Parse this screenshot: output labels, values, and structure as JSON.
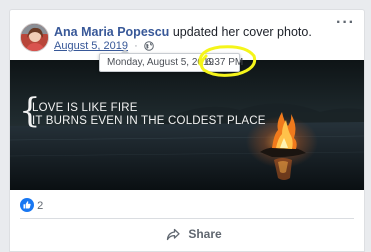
{
  "post": {
    "author_name": "Ana Maria Popescu",
    "action_text": "updated her cover photo.",
    "date_link": "August 5, 2019",
    "privacy_icon": "globe-icon",
    "more_icon": "more-options-icon"
  },
  "tooltip": {
    "date": "Monday, August 5, 2019",
    "time": "6:37 PM"
  },
  "cover_photo": {
    "quote_line_1": "LOVE IS LIKE FIRE",
    "quote_line_2": "IT BURNS EVEN IN THE COLDEST PLACE"
  },
  "reactions": {
    "icon": "like-icon",
    "count": "2"
  },
  "actions": {
    "share_label": "Share",
    "share_icon": "share-arrow-icon"
  },
  "colors": {
    "link_blue": "#385898",
    "like_blue": "#1877f2",
    "highlight_yellow": "#f5f51a"
  }
}
